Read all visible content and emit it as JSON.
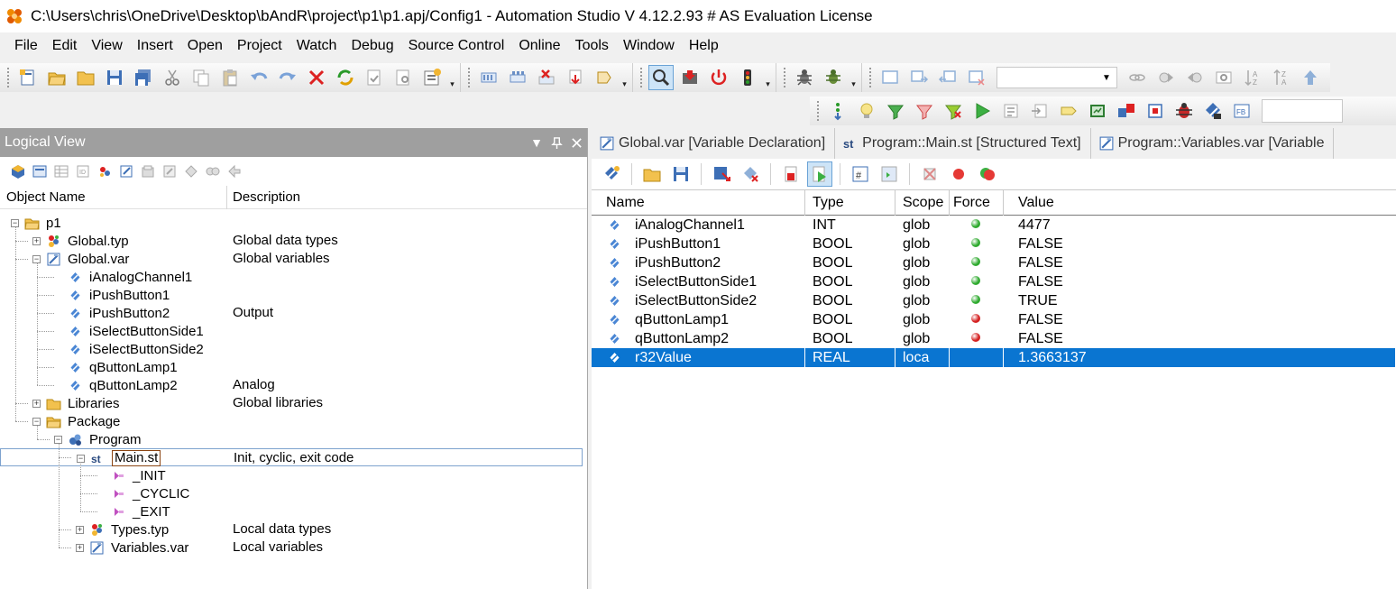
{
  "window": {
    "title": "C:\\Users\\chris\\OneDrive\\Desktop\\bAndR\\project\\p1\\p1.apj/Config1 - Automation Studio V 4.12.2.93 # AS Evaluation License"
  },
  "menu": [
    "File",
    "Edit",
    "View",
    "Insert",
    "Open",
    "Project",
    "Watch",
    "Debug",
    "Source Control",
    "Online",
    "Tools",
    "Window",
    "Help"
  ],
  "logical_view": {
    "title": "Logical View",
    "columns": {
      "name": "Object Name",
      "description": "Description"
    },
    "tree": [
      {
        "label": "p1",
        "description": "",
        "icon": "project-folder-icon",
        "depth": 0,
        "expander": "minus"
      },
      {
        "label": "Global.typ",
        "description": "Global data types",
        "icon": "datatype-icon",
        "depth": 1,
        "expander": "plus"
      },
      {
        "label": "Global.var",
        "description": "Global variables",
        "icon": "variable-file-icon",
        "depth": 1,
        "expander": "minus"
      },
      {
        "label": "iAnalogChannel1",
        "description": "",
        "icon": "variable-icon",
        "depth": 2,
        "expander": ""
      },
      {
        "label": "iPushButton1",
        "description": "",
        "icon": "variable-icon",
        "depth": 2,
        "expander": ""
      },
      {
        "label": "iPushButton2",
        "description": "Output",
        "icon": "variable-icon",
        "depth": 2,
        "expander": ""
      },
      {
        "label": "iSelectButtonSide1",
        "description": "",
        "icon": "variable-icon",
        "depth": 2,
        "expander": ""
      },
      {
        "label": "iSelectButtonSide2",
        "description": "",
        "icon": "variable-icon",
        "depth": 2,
        "expander": ""
      },
      {
        "label": "qButtonLamp1",
        "description": "",
        "icon": "variable-icon",
        "depth": 2,
        "expander": ""
      },
      {
        "label": "qButtonLamp2",
        "description": "Analog",
        "icon": "variable-icon",
        "depth": 2,
        "expander": ""
      },
      {
        "label": "Libraries",
        "description": "Global libraries",
        "icon": "folder-icon",
        "depth": 1,
        "expander": "plus"
      },
      {
        "label": "Package",
        "description": "",
        "icon": "package-icon",
        "depth": 1,
        "expander": "minus"
      },
      {
        "label": "Program",
        "description": "",
        "icon": "program-icon",
        "depth": 2,
        "expander": "minus"
      },
      {
        "label": "Main.st",
        "description": "Init, cyclic, exit code",
        "icon": "structured-text-icon",
        "depth": 3,
        "expander": "minus",
        "selected": true
      },
      {
        "label": "_INIT",
        "description": "",
        "icon": "routine-icon",
        "depth": 4,
        "expander": ""
      },
      {
        "label": "_CYCLIC",
        "description": "",
        "icon": "routine-icon",
        "depth": 4,
        "expander": ""
      },
      {
        "label": "_EXIT",
        "description": "",
        "icon": "routine-icon",
        "depth": 4,
        "expander": ""
      },
      {
        "label": "Types.typ",
        "description": "Local data types",
        "icon": "datatype-icon",
        "depth": 3,
        "expander": "plus"
      },
      {
        "label": "Variables.var",
        "description": "Local variables",
        "icon": "variable-file-icon",
        "depth": 3,
        "expander": "plus"
      }
    ]
  },
  "editor": {
    "tabs": [
      {
        "label": "Global.var [Variable Declaration]",
        "icon": "variable-file-icon"
      },
      {
        "label": "Program::Main.st [Structured Text]",
        "icon": "structured-text-icon"
      },
      {
        "label": "Program::Variables.var [Variable",
        "icon": "variable-file-icon"
      }
    ],
    "watch": {
      "columns": [
        "Name",
        "Type",
        "Scope",
        "Force",
        "Value"
      ],
      "rows": [
        {
          "name": "iAnalogChannel1",
          "type": "INT",
          "scope": "glob",
          "force": "green",
          "value": "4477"
        },
        {
          "name": "iPushButton1",
          "type": "BOOL",
          "scope": "glob",
          "force": "green",
          "value": "FALSE"
        },
        {
          "name": "iPushButton2",
          "type": "BOOL",
          "scope": "glob",
          "force": "green",
          "value": "FALSE"
        },
        {
          "name": "iSelectButtonSide1",
          "type": "BOOL",
          "scope": "glob",
          "force": "green",
          "value": "FALSE"
        },
        {
          "name": "iSelectButtonSide2",
          "type": "BOOL",
          "scope": "glob",
          "force": "green",
          "value": "TRUE"
        },
        {
          "name": "qButtonLamp1",
          "type": "BOOL",
          "scope": "glob",
          "force": "red",
          "value": "FALSE"
        },
        {
          "name": "qButtonLamp2",
          "type": "BOOL",
          "scope": "glob",
          "force": "red",
          "value": "FALSE"
        },
        {
          "name": "r32Value",
          "type": "REAL",
          "scope": "loca",
          "force": "",
          "value": "1.3663137",
          "selected": true
        }
      ]
    }
  },
  "colors": {
    "selection": "#0a75d1",
    "panel_header": "#9f9f9f",
    "led_green": "#2eaa2e",
    "led_red": "#d42020"
  }
}
